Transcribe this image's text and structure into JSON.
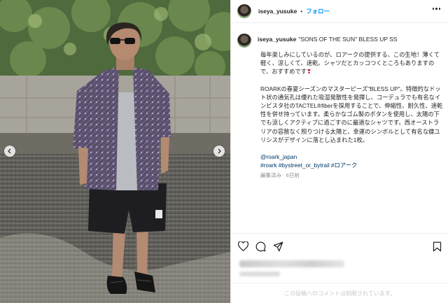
{
  "post": {
    "username": "iseya_yusuke",
    "follow_label": "フォロー",
    "separator": "•",
    "caption_title": "\"SONS OF THE SUN\" BLESS UP SS",
    "paragraph1": "毎年楽しみにしているのが、ロアークの提供する、この生地！薄くて軽く、涼しくて、速乾。シャツだとカッコつくところもありますので、おすすめです",
    "paragraph2": "ROARKの春夏シーズンのマスターピーズ\"BLESS UP\"。特徴的なドット状の通気孔は優れた吸湿発散性を発揮し、コーデュラでも有名なインビスタ社のTACTEL®fiberを採用することで、伸縮性、耐久性、速乾性を併せ持っています。柔らかなゴム製のボタンを使用し、太陽の下でも涼しくアクティブに過ごすのに最適なシャツです。西オーストラリアの容赦なく照りつける太陽と、幸運のシンボルとして有名な蝶ユリシスがデザインに落とし込まれた1枚。",
    "mention": "@roark_japan",
    "hashtags": "#roark #bystreet_or_bytrail #ロアーク",
    "meta": "編集済み · 6日前",
    "comments_disabled": "この投稿へのコメントは制限されています。"
  },
  "icons": {
    "more": "more-horizontal-icon",
    "like": "heart-outline-icon",
    "comment": "comment-bubble-icon",
    "share": "paper-plane-icon",
    "save": "bookmark-icon",
    "prev": "chevron-left-icon",
    "next": "chevron-right-icon",
    "red_heart": "red-heart-emoji"
  },
  "colors": {
    "link": "#0095f6",
    "hashtag": "#00376b",
    "muted": "#8e8e8e",
    "heart": "#d0152d"
  }
}
